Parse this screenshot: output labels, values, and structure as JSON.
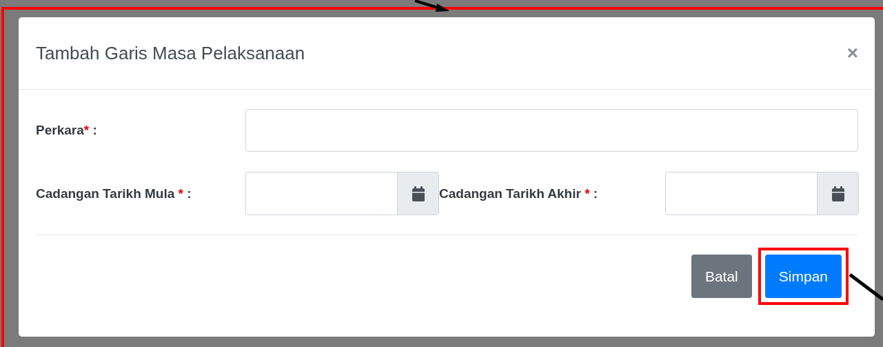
{
  "dialog": {
    "title": "Tambah Garis Masa Pelaksanaan",
    "close": "×",
    "fields": [
      {
        "kind": "text",
        "label": "Perkara",
        "marker": "*",
        "colon": " :"
      },
      {
        "kind": "date",
        "label": "Cadangan Tarikh Mula ",
        "marker": "*",
        "colon": " :"
      },
      {
        "kind": "date",
        "label": "Cadangan Tarikh Akhir ",
        "marker": "*",
        "colon": " :"
      }
    ],
    "buttons": [
      {
        "label": "Batal",
        "kind": "secondary",
        "highlighted": false
      },
      {
        "label": "Simpan",
        "kind": "primary",
        "highlighted": true
      }
    ]
  }
}
